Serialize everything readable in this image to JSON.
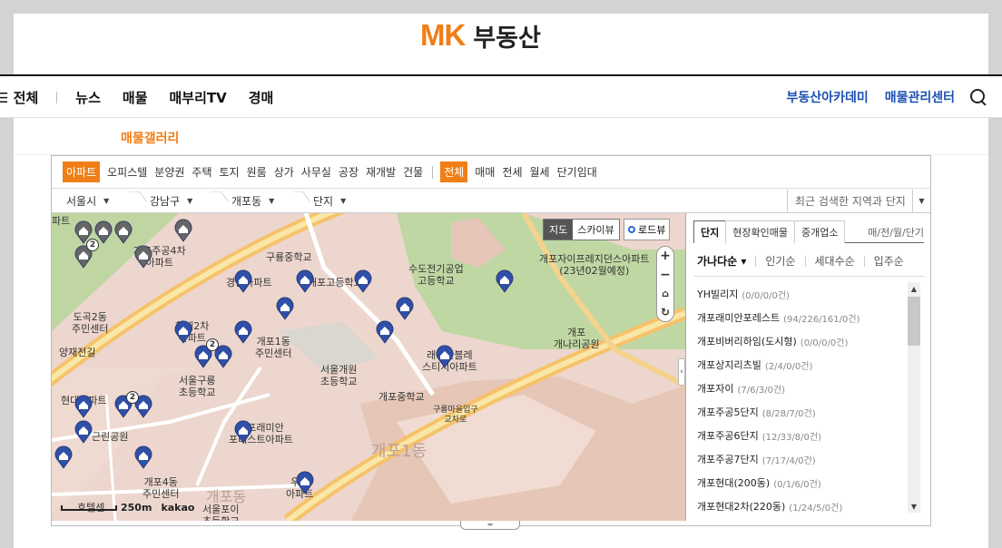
{
  "header": {
    "logo_mk": "MK",
    "logo_text": "부동산"
  },
  "nav": {
    "all": "☰ 전체",
    "items": [
      "뉴스",
      "매물",
      "매부리TV",
      "경매"
    ],
    "right": [
      "부동산아카데미",
      "매물관리센터"
    ]
  },
  "subnav": {
    "active": "매물갤러리"
  },
  "widget": {
    "type_tabs": [
      "아파트",
      "오피스텔",
      "분양권",
      "주택",
      "토지",
      "원룸",
      "상가",
      "사무실",
      "공장",
      "재개발",
      "건물"
    ],
    "deal_tabs": [
      "전체",
      "매매",
      "전세",
      "월세",
      "단기임대"
    ],
    "breadcrumbs": [
      "서울시",
      "강남구",
      "개포동",
      "단지"
    ],
    "recent_label": "최근 검색한 지역과 단지"
  },
  "map": {
    "type_map": "지도",
    "type_sky": "스카이뷰",
    "roadview": "로드뷰",
    "zoom_in": "+",
    "zoom_out": "−",
    "scale": "250m",
    "brand": "kakao",
    "labels": {
      "l1": "구룡중학교",
      "l2": "수도전기공업\n고등학교",
      "l3": "개포자이프레지던스아파트\n(23년02월예정)",
      "l4": "개포\n개나리공원",
      "l5": "도곡2동\n주민센터",
      "l6": "개포1동\n주민센터",
      "l7": "서울개원\n초등학교",
      "l8": "개포중학교",
      "l9": "서울구룡\n초등학교",
      "l10": "개포4동\n주민센터",
      "l11": "구룡마을입구\n교차로",
      "l12": "개포1동",
      "l13": "개포고등학교",
      "l14": "개포래미안\n포레스트아파트",
      "l15": "래미안블레\n스티지아파트",
      "l16": "양재전길",
      "l17": "근린공원",
      "l18": "개포주공4차\n아파트",
      "l19": "서울포이\n초등학교",
      "l20": "파트",
      "l21": "경남아파트",
      "l22": "현대2차\n아파트",
      "l23": "현대아파트",
      "l24": "우성\n아파트",
      "l25": "호텔센",
      "l26": "개포동"
    },
    "clusters": [
      "2",
      "2",
      "2"
    ]
  },
  "panel": {
    "tabs": [
      "단지",
      "현장확인매물",
      "중개업소"
    ],
    "unit": "매/전/월/단기",
    "sorts": [
      "가나다순 ▾",
      "인기순",
      "세대수순",
      "입주순"
    ],
    "list": [
      {
        "name": "YH빌리지",
        "count": "(0/0/0/0건)"
      },
      {
        "name": "개포래미안포레스트",
        "count": "(94/226/161/0건)"
      },
      {
        "name": "개포비버리하임(도시형)",
        "count": "(0/0/0/0건)"
      },
      {
        "name": "개포상지리츠빌",
        "count": "(2/4/0/0건)"
      },
      {
        "name": "개포자이",
        "count": "(7/6/3/0건)"
      },
      {
        "name": "개포주공5단지",
        "count": "(8/28/7/0건)"
      },
      {
        "name": "개포주공6단지",
        "count": "(12/33/8/0건)"
      },
      {
        "name": "개포주공7단지",
        "count": "(7/17/4/0건)"
      },
      {
        "name": "개포현대(200동)",
        "count": "(0/1/6/0건)"
      },
      {
        "name": "개포현대2차(220동)",
        "count": "(1/24/5/0건)"
      }
    ]
  },
  "colors": {
    "accent": "#f07e16",
    "link": "#1c4fb1",
    "pin": "#2f4fa8",
    "pin_gray": "#666666",
    "park": "#c5d9a6"
  }
}
